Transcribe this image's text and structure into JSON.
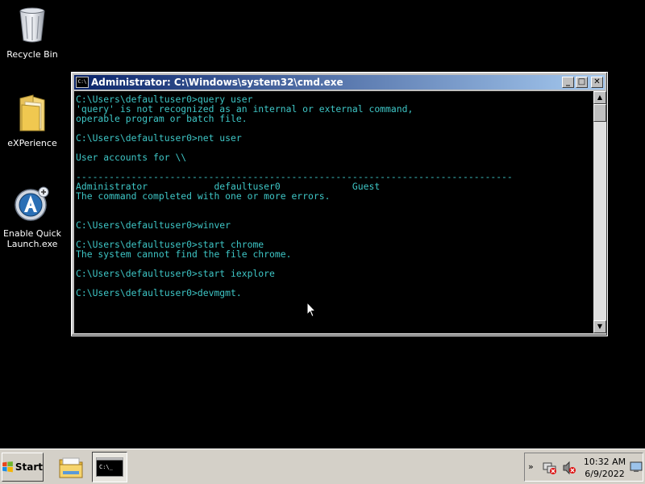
{
  "desktop": {
    "icons": [
      {
        "label": "Recycle Bin",
        "icon": "recycle-bin-icon"
      },
      {
        "label": "eXPerience",
        "icon": "folder-icon"
      },
      {
        "label": "Enable Quick Launch.exe",
        "icon": "app-icon"
      }
    ]
  },
  "cmd_window": {
    "title": "Administrator: C:\\Windows\\system32\\cmd.exe",
    "buttons": {
      "minimize": "_",
      "maximize": "□",
      "close": "✕"
    },
    "console_text": "C:\\Users\\defaultuser0>query user\n'query' is not recognized as an internal or external command,\noperable program or batch file.\n\nC:\\Users\\defaultuser0>net user\n\nUser accounts for \\\\\n\n-------------------------------------------------------------------------------\nAdministrator            defaultuser0             Guest\nThe command completed with one or more errors.\n\n\nC:\\Users\\defaultuser0>winver\n\nC:\\Users\\defaultuser0>start chrome\nThe system cannot find the file chrome.\n\nC:\\Users\\defaultuser0>start iexplore\n\nC:\\Users\\defaultuser0>devmgmt.",
    "text_color": "#3ec6c6",
    "background": "#000000"
  },
  "taskbar": {
    "start_label": "Start",
    "items": [
      {
        "name": "Windows Explorer",
        "icon": "explorer-icon"
      },
      {
        "name": "cmd.exe",
        "icon": "cmd-icon",
        "active": true
      }
    ],
    "tray": {
      "time": "10:32 AM",
      "date": "6/9/2022",
      "chevron": "»"
    }
  }
}
